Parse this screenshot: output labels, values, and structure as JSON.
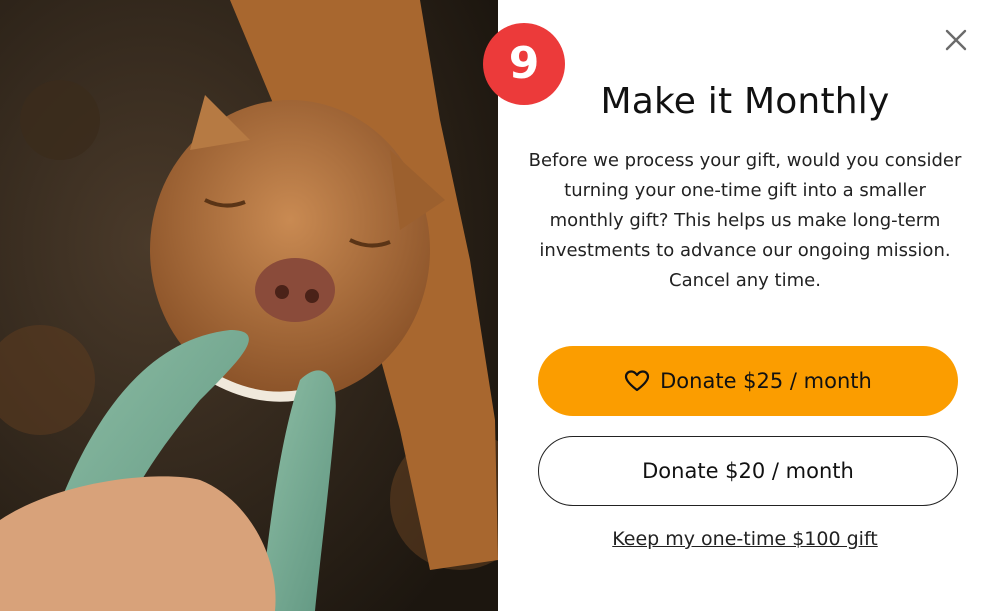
{
  "step_badge": "9",
  "modal": {
    "title": "Make it Monthly",
    "body": "Before we process your gift, would you consider turning your one-time gift into a smaller monthly gift? This helps us make long-term investments to advance our ongoing mission. Cancel any time.",
    "primary_button": "Donate $25 / month",
    "secondary_button": "Donate $20 / month",
    "decline_link": "Keep my one-time $100 gift"
  },
  "icons": {
    "close": "close-icon",
    "heart": "heart-icon"
  },
  "colors": {
    "accent": "#fb9d00",
    "badge": "#ec3a3a",
    "text": "#111111",
    "background": "#ffffff"
  }
}
